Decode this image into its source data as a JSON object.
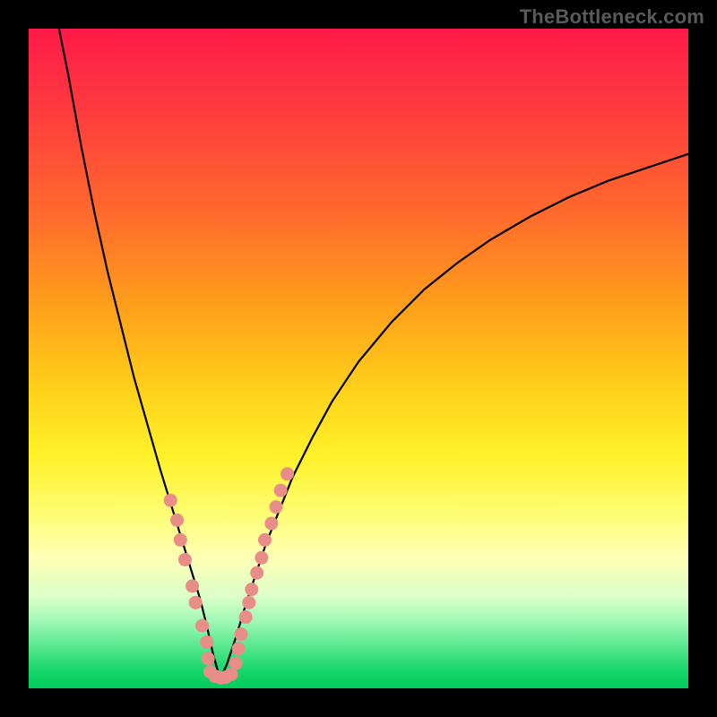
{
  "watermark": "TheBottleneck.com",
  "colors": {
    "frame": "#000000",
    "gradient_top": "#ff1a49",
    "gradient_bottom": "#00cc5a",
    "curve": "#000000",
    "beads": "#e88d87"
  },
  "chart_data": {
    "type": "line",
    "title": "",
    "xlabel": "",
    "ylabel": "",
    "xlim": [
      0,
      100
    ],
    "ylim": [
      0,
      100
    ],
    "grid": false,
    "note": "Axes are unlabeled in the source image; x and y are normalized 0–100 from pixel geometry. y=0 at bottom (green), y=100 at top (red). Two black curves form a V with minimum near x≈29.",
    "series": [
      {
        "name": "left-branch",
        "x": [
          4.6,
          6.0,
          8.0,
          10.0,
          12.0,
          14.0,
          16.0,
          18.0,
          20.0,
          22.0,
          24.0,
          26.0,
          27.0,
          28.0,
          29.0
        ],
        "y": [
          100.0,
          93.0,
          82.0,
          72.0,
          63.0,
          55.0,
          47.0,
          40.0,
          33.0,
          26.5,
          20.0,
          13.5,
          9.5,
          5.0,
          1.5
        ]
      },
      {
        "name": "right-branch",
        "x": [
          29.0,
          30.0,
          31.5,
          33.0,
          34.5,
          36.0,
          38.0,
          40.0,
          43.0,
          46.0,
          50.0,
          55.0,
          60.0,
          65.0,
          70.0,
          76.0,
          82.0,
          88.0,
          94.0,
          100.0
        ],
        "y": [
          1.5,
          3.5,
          8.0,
          13.0,
          17.5,
          22.0,
          27.0,
          32.0,
          38.0,
          43.5,
          49.5,
          55.5,
          60.5,
          64.5,
          68.0,
          71.5,
          74.5,
          77.0,
          79.0,
          81.0
        ]
      }
    ],
    "markers": {
      "name": "pink-beads",
      "color": "#e88d87",
      "note": "Clustered salmon dots tracing the curve near the valley on both branches.",
      "points": [
        {
          "x": 21.5,
          "y": 28.5
        },
        {
          "x": 22.5,
          "y": 25.5
        },
        {
          "x": 23.0,
          "y": 22.5
        },
        {
          "x": 23.7,
          "y": 19.5
        },
        {
          "x": 24.8,
          "y": 15.5
        },
        {
          "x": 25.3,
          "y": 13.0
        },
        {
          "x": 26.3,
          "y": 9.5
        },
        {
          "x": 27.0,
          "y": 7.0
        },
        {
          "x": 27.2,
          "y": 4.5
        },
        {
          "x": 27.5,
          "y": 2.5
        },
        {
          "x": 28.3,
          "y": 1.8
        },
        {
          "x": 29.1,
          "y": 1.6
        },
        {
          "x": 29.9,
          "y": 1.7
        },
        {
          "x": 30.7,
          "y": 2.1
        },
        {
          "x": 31.4,
          "y": 3.8
        },
        {
          "x": 31.8,
          "y": 6.0
        },
        {
          "x": 32.2,
          "y": 8.2
        },
        {
          "x": 32.9,
          "y": 10.8
        },
        {
          "x": 33.4,
          "y": 13.0
        },
        {
          "x": 33.8,
          "y": 15.0
        },
        {
          "x": 34.6,
          "y": 17.5
        },
        {
          "x": 35.3,
          "y": 19.8
        },
        {
          "x": 35.8,
          "y": 22.5
        },
        {
          "x": 36.8,
          "y": 25.0
        },
        {
          "x": 37.5,
          "y": 27.5
        },
        {
          "x": 38.2,
          "y": 30.0
        },
        {
          "x": 39.2,
          "y": 32.5
        }
      ]
    }
  }
}
